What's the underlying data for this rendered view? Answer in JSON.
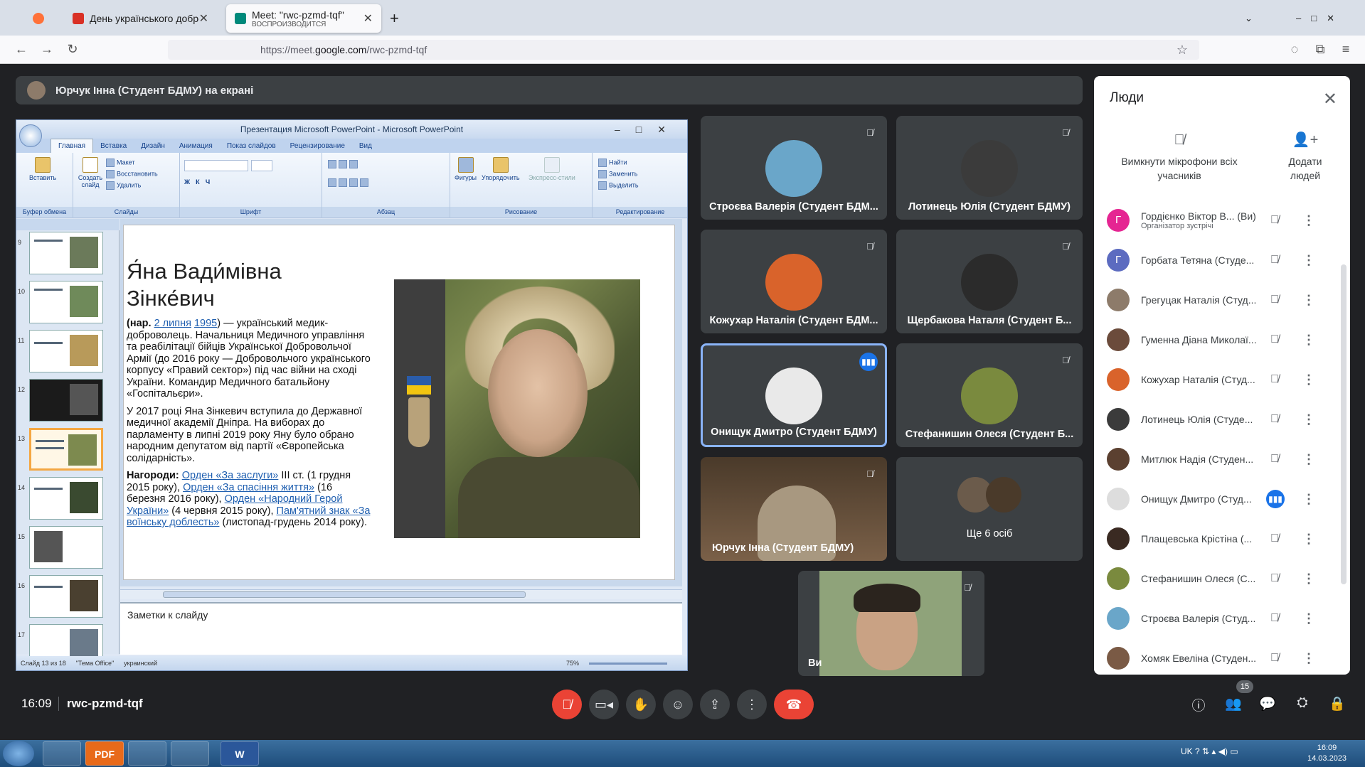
{
  "browser": {
    "tabs": [
      {
        "label": "День українського добровольця",
        "favicon_color": "#d93025"
      },
      {
        "label": "Meet: \"rwc-pzmd-tqf\"",
        "sublabel": "ВОСПРОИЗВОДИТСЯ",
        "favicon_color": "#00897b"
      }
    ],
    "url_prefix": "https://meet.",
    "url_host": "google.com",
    "url_path": "/rwc-pzmd-tqf"
  },
  "meet": {
    "presenting_banner": "Юрчук Інна (Студент БДМУ) на екрані",
    "time": "16:09",
    "meeting_code": "rwc-pzmd-tqf",
    "participant_count": "15",
    "tiles": [
      {
        "name": "Строєва Валерія (Студент БДМ...",
        "avatar_color": "#6aa6c9",
        "muted": true
      },
      {
        "name": "Лотинець Юлія (Студент БДМУ)",
        "avatar_color": "#3b3b3b",
        "muted": true
      },
      {
        "name": "Кожухар Наталія (Студент БДМ...",
        "avatar_color": "#d9632b",
        "muted": true
      },
      {
        "name": "Щербакова Наталя (Студент Б...",
        "avatar_color": "#2b2b2b",
        "muted": true
      },
      {
        "name": "Онищук Дмитро (Студент БДМУ)",
        "avatar_color": "#e9e9e9",
        "muted": false
      },
      {
        "name": "Стефанишин Олеся (Студент Б...",
        "avatar_color": "#7a8a3e",
        "muted": true
      },
      {
        "name": "Юрчук Інна (Студент БДМУ)",
        "avatar_color": "#a89880",
        "muted": true
      },
      {
        "name": "Ще 6 осіб",
        "avatar_color": "#6b5b4b",
        "muted": false
      },
      {
        "name": "Ви",
        "avatar_color": "#8fa37a",
        "muted": true
      }
    ]
  },
  "people_panel": {
    "title": "Люди",
    "mute_all_label": "Вимкнути мікрофони всіх учасників",
    "add_people_label": "Додати людей",
    "participants": [
      {
        "initial": "Г",
        "name": "Гордієнко Віктор В... (Ви)",
        "sub": "Організатор зустрічі",
        "color": "#e52592",
        "talking": false
      },
      {
        "initial": "Г",
        "name": "Горбата Тетяна (Студе...",
        "sub": "",
        "color": "#5c6bc0",
        "talking": false
      },
      {
        "initial": "",
        "name": "Грегуцак Наталія (Студ...",
        "sub": "",
        "color": "#8d7b6a",
        "talking": false
      },
      {
        "initial": "",
        "name": "Гуменна Діана Миколаї...",
        "sub": "",
        "color": "#6b4b3b",
        "talking": false
      },
      {
        "initial": "",
        "name": "Кожухар Наталія (Студ...",
        "sub": "",
        "color": "#d9632b",
        "talking": false
      },
      {
        "initial": "",
        "name": "Лотинець Юлія (Студе...",
        "sub": "",
        "color": "#3b3b3b",
        "talking": false
      },
      {
        "initial": "",
        "name": "Митлюк Надія (Студен...",
        "sub": "",
        "color": "#5b4030",
        "talking": false
      },
      {
        "initial": "",
        "name": "Онищук Дмитро (Студ...",
        "sub": "",
        "color": "#dddddd",
        "talking": true
      },
      {
        "initial": "",
        "name": "Плащевська Крістіна (...",
        "sub": "",
        "color": "#3a2a22",
        "talking": false
      },
      {
        "initial": "",
        "name": "Стефанишин Олеся (С...",
        "sub": "",
        "color": "#7a8a3e",
        "talking": false
      },
      {
        "initial": "",
        "name": "Строєва Валерія (Студ...",
        "sub": "",
        "color": "#6aa6c9",
        "talking": false
      },
      {
        "initial": "",
        "name": "Хомяк Евеліна (Студен...",
        "sub": "",
        "color": "#7a5a45",
        "talking": false
      }
    ]
  },
  "powerpoint": {
    "window_title": "Презентация Microsoft PowerPoint - Microsoft PowerPoint",
    "ribbon_tabs": [
      "Главная",
      "Вставка",
      "Дизайн",
      "Анимация",
      "Показ слайдов",
      "Рецензирование",
      "Вид"
    ],
    "ribbon": {
      "paste": "Вставить",
      "new_slide": "Создать слайд",
      "layout": "Макет",
      "reset": "Восстановить",
      "delete": "Удалить",
      "shapes": "Фигуры",
      "arrange": "Упорядочить",
      "quick_styles": "Экспресс-стили",
      "find": "Найти",
      "replace": "Заменить",
      "select": "Выделить",
      "groups": [
        "Буфер обмена",
        "Слайды",
        "Шрифт",
        "Абзац",
        "Рисование",
        "Редактирование"
      ]
    },
    "thumbnail_numbers": [
      "9",
      "10",
      "11",
      "12",
      "13",
      "14",
      "15",
      "16",
      "17"
    ],
    "slide": {
      "title": "Я́на Вади́мівна Зінке́вич",
      "intro_prefix": "(нар. ",
      "birth_day": "2 липня",
      "birth_year": "1995",
      "intro_rest": ") — український медик-доброволець. Начальниця Медичного управління та реабілітації бійців Української Добровольчої Армії (до 2016 року — Добровольчого українського корпусу «Правий сектор») під час війни на сході України. Командир Медичного батальйону «Госпітальєри».",
      "para2": "У 2017 році Яна Зінкевич вступила до Державної медичної академії Дніпра. На виборах до парламенту в липні 2019 року Яну було обрано народним депутатом від партії «Європейська солідарність».",
      "awards_label": "Нагороди:",
      "award1": "Орден «За заслуги»",
      "award1_rest": " III ст. (1 грудня 2015 року), ",
      "award2": "Орден «За спасіння життя»",
      "award2_rest": " (16 березня 2016 року), ",
      "award3": "Орден «Народний Герой України»",
      "award3_rest": " (4 червня 2015 року), ",
      "award4": "Пам'ятний знак «За воїнську доблесть»",
      "award4_rest": " (листопад-грудень 2014 року)."
    },
    "notes_placeholder": "Заметки к слайду",
    "status": {
      "slide_counter": "Слайд 13 из 18",
      "theme": "\"Тема Office\"",
      "language": "украинский",
      "zoom": "75%"
    }
  },
  "taskbar": {
    "apps": [
      "",
      "PDF",
      "",
      "",
      "W"
    ],
    "language": "UK",
    "clock_time": "16:09",
    "clock_date": "14.03.2023"
  }
}
